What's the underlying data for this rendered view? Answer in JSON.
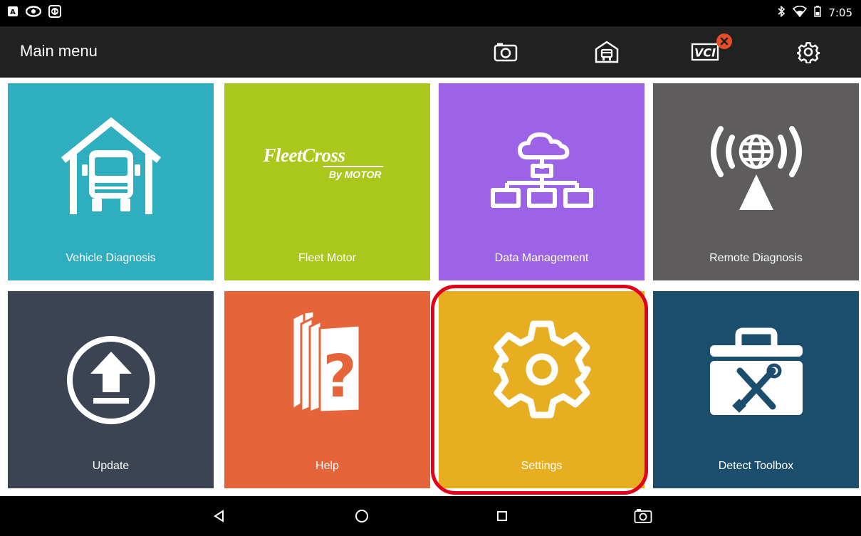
{
  "status_bar": {
    "time": "7:05",
    "left_icons": [
      "a-icon",
      "eye-icon",
      "teamviewer-icon"
    ],
    "right_icons": [
      "bluetooth-icon",
      "wifi-icon",
      "battery-icon"
    ]
  },
  "app_bar": {
    "title": "Main menu",
    "actions": [
      {
        "name": "screenshot-icon"
      },
      {
        "name": "garage-icon"
      },
      {
        "name": "vci-icon",
        "label": "VCI",
        "badge": "disconnected-x-icon"
      },
      {
        "name": "gear-icon"
      }
    ]
  },
  "tiles": [
    {
      "label": "Vehicle Diagnosis",
      "icon": "truck-garage-icon",
      "color": "#2eaebf"
    },
    {
      "label": "Fleet Motor",
      "icon": "fleetcross-logo",
      "logo_text": "FleetCross",
      "logo_sub": "By MOTOR",
      "color": "#aac71b"
    },
    {
      "label": "Data Management",
      "icon": "cloud-network-icon",
      "color": "#9c63e6"
    },
    {
      "label": "Remote Diagnosis",
      "icon": "globe-signal-icon",
      "color": "#5e5c5c"
    },
    {
      "label": "Update",
      "icon": "upload-arrow-icon",
      "color": "#3c4353"
    },
    {
      "label": "Help",
      "icon": "help-books-icon",
      "color": "#e6643a"
    },
    {
      "label": "Settings",
      "icon": "gear-large-icon",
      "color": "#e8ae21"
    },
    {
      "label": "Detect Toolbox",
      "icon": "toolbox-icon",
      "color": "#1b4e6d"
    }
  ],
  "highlight_color": "#e2001a",
  "nav_bar": {
    "buttons": [
      "back-icon",
      "home-icon",
      "recents-icon",
      "screenshot-icon"
    ]
  }
}
